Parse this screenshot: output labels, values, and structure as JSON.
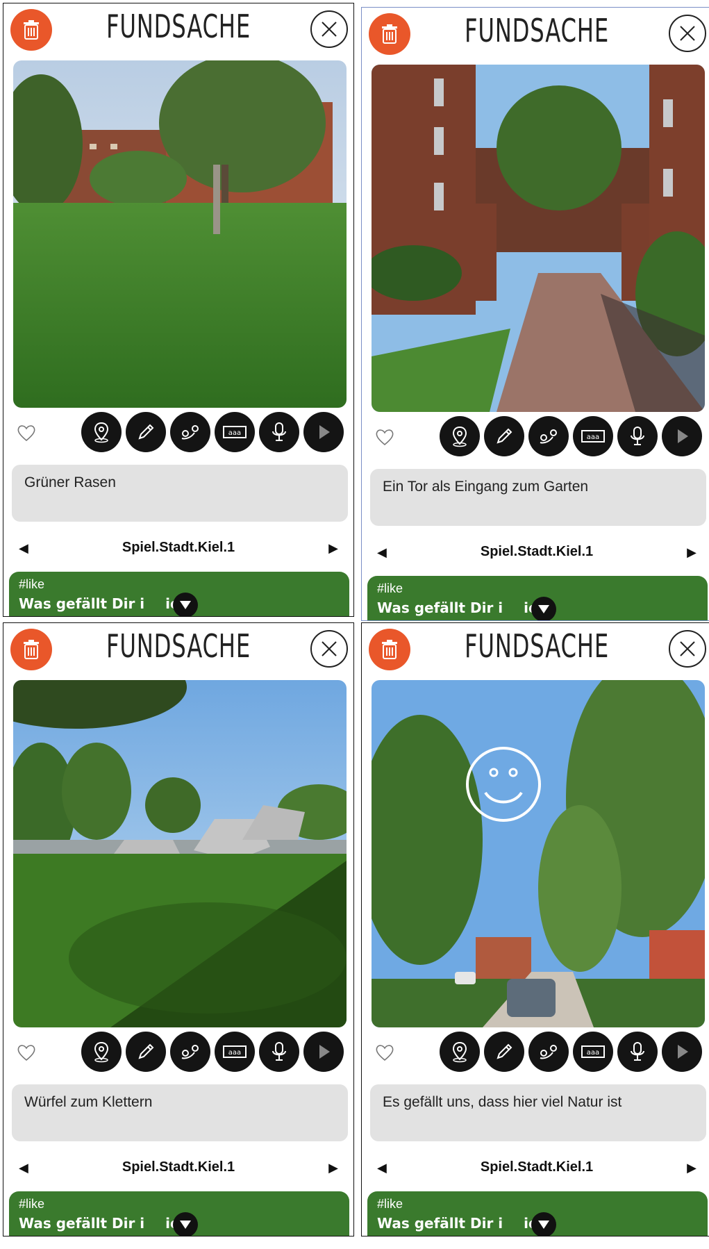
{
  "app": {
    "title": "FUNDSACHE"
  },
  "panels": [
    {
      "caption": "Grüner Rasen",
      "place": "Spiel.Stadt.Kiel.1",
      "tag": "#like",
      "question": "Was gefällt Dir i",
      "question_tail": "iel-"
    },
    {
      "caption": "Ein Tor als Eingang zum Garten",
      "place": "Spiel.Stadt.Kiel.1",
      "tag": "#like",
      "question": "Was gefällt Dir i",
      "question_tail": "iel-"
    },
    {
      "caption": "Würfel zum Klettern",
      "place": "Spiel.Stadt.Kiel.1",
      "tag": "#like",
      "question": "Was gefällt Dir i",
      "question_tail": "iel-"
    },
    {
      "caption": "Es gefällt uns, dass hier viel Natur ist",
      "place": "Spiel.Stadt.Kiel.1",
      "tag": "#like",
      "question": "Was gefällt Dir i",
      "question_tail": "iel-"
    }
  ],
  "nav": {
    "prev_glyph": "◀",
    "next_glyph": "▶"
  },
  "colors": {
    "accent_orange": "#e9572a",
    "accent_green": "#3a7a2d",
    "caption_bg": "#e2e2e2",
    "tool_bg": "#141414"
  },
  "icons": [
    "trash-icon",
    "close-icon",
    "heart-icon",
    "location-pin-icon",
    "pencil-icon",
    "route-icon",
    "abc-text-icon",
    "microphone-icon",
    "play-icon",
    "chevron-down-icon"
  ]
}
